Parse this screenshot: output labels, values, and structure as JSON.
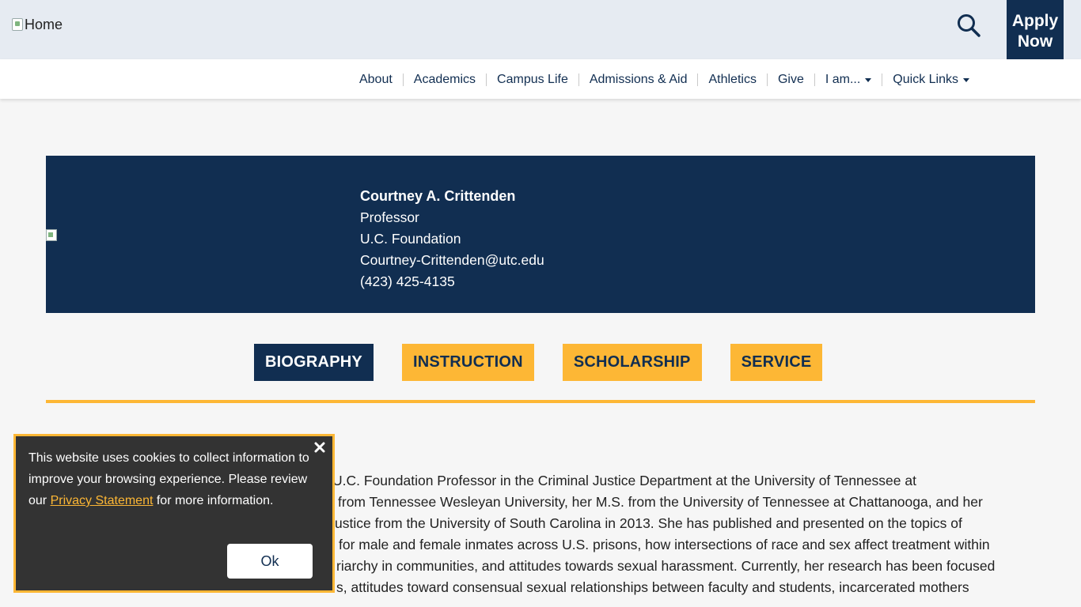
{
  "header": {
    "logo_alt": "Home",
    "apply_line1": "Apply",
    "apply_line2": "Now",
    "nav": [
      {
        "label": "About"
      },
      {
        "label": "Academics"
      },
      {
        "label": "Campus Life"
      },
      {
        "label": "Admissions & Aid"
      },
      {
        "label": "Athletics"
      },
      {
        "label": "Give"
      },
      {
        "label": "I am..."
      },
      {
        "label": "Quick Links"
      }
    ]
  },
  "profile": {
    "name": "Courtney A. Crittenden",
    "title": "Professor",
    "chair": "U.C. Foundation",
    "email": "Courtney-Crittenden@utc.edu",
    "phone": "(423) 425-4135"
  },
  "tabs": [
    {
      "label": "BIOGRAPHY",
      "active": true
    },
    {
      "label": "INSTRUCTION",
      "active": false
    },
    {
      "label": "SCHOLARSHIP",
      "active": false
    },
    {
      "label": "SERVICE",
      "active": false
    }
  ],
  "bio": {
    "lines": [
      "U.C. Foundation Professor in the Criminal Justice Department at the University of Tennessee at",
      "from Tennessee Wesleyan University, her M.S. from the University of Tennessee at Chattanooga, and her",
      "ustice from the University of South Carolina in 2013. She has published and presented on the topics of",
      "for male and female inmates across U.S. prisons, how intersections of race and sex affect treatment within",
      "riarchy in communities, and attitudes towards sexual harassment. Currently, her research has been focused",
      "s, attitudes toward consensual sexual relationships between faculty and students, incarcerated mothers"
    ]
  },
  "cookie": {
    "text_before": "This website uses cookies to collect information to improve your browsing experience. Please review our ",
    "link": "Privacy Statement",
    "text_after": " for more information.",
    "ok_label": "Ok"
  },
  "colors": {
    "navy": "#112e51",
    "gold": "#fdb735",
    "topbar": "#e6ebf2",
    "cookie_bg": "#333333"
  }
}
